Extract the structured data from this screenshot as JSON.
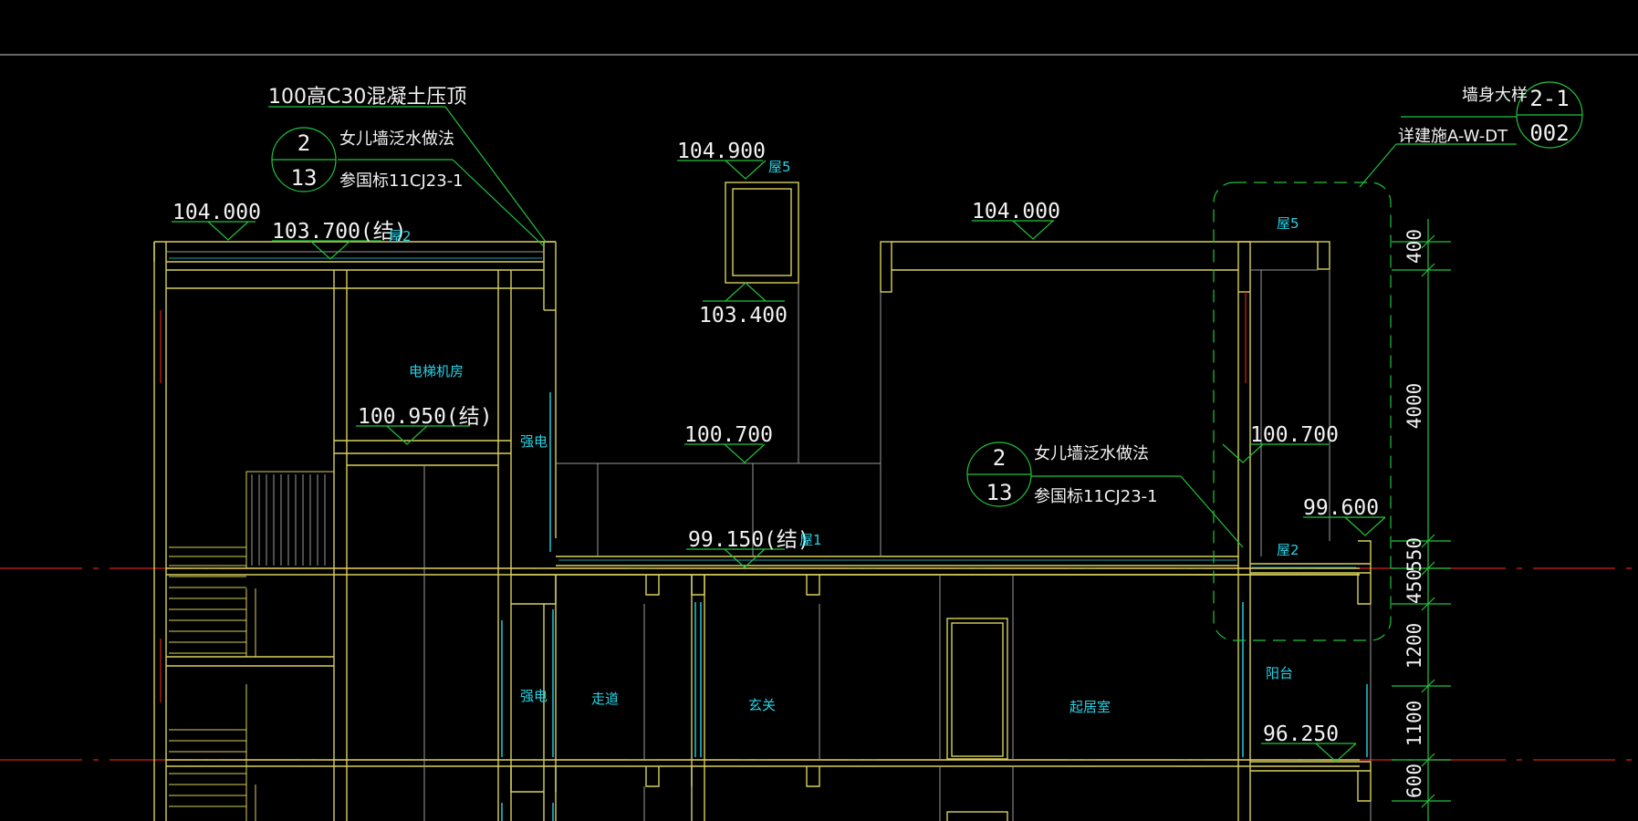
{
  "colors": {
    "background": "#000000",
    "wall": "#d8d05a",
    "leader": "#22c33a",
    "thin": "#9a9a9a",
    "axis": "#d42020",
    "window": "#27d3e6",
    "text": "#f2f2f2"
  },
  "notes": {
    "coping": "100高C30混凝土压顶",
    "parapet_a": "女儿墙泛水做法",
    "standard_a": "参国标11CJ23-1",
    "parapet_b": "女儿墙泛水做法",
    "standard_b": "参国标11CJ23-1",
    "wall_detail": "墙身大样",
    "detail_ref": "详建施A-W-DT"
  },
  "detail_symbols": {
    "parapet_a": {
      "top": "2",
      "bottom": "13"
    },
    "parapet_b": {
      "top": "2",
      "bottom": "13"
    },
    "wall": {
      "top": "2-1",
      "bottom": "002"
    }
  },
  "elevations": {
    "e104_900": "104.900",
    "e104_000_left": "104.000",
    "e103_700": "103.700(结)",
    "e103_400": "103.400",
    "e104_000_right": "104.000",
    "e100_950": "100.950(结)",
    "e100_700_mid": "100.700",
    "e100_700_right": "100.700",
    "e99_600": "99.600",
    "e99_150": "99.150(结)",
    "e96_250": "96.250"
  },
  "level_tags": {
    "roof5_top": "屋5",
    "roof2_left": "屋2",
    "roof5_right": "屋5",
    "roof1": "屋1",
    "roof2_right": "屋2"
  },
  "rooms": {
    "elevator_room": "电梯机房",
    "power_upper": "强电",
    "power_lower": "强电",
    "corridor": "走道",
    "entrance": "玄关",
    "living_room": "起居室",
    "balcony": "阳台"
  },
  "dimensions": [
    "400",
    "4000",
    "550",
    "450",
    "1200",
    "1100",
    "600"
  ]
}
